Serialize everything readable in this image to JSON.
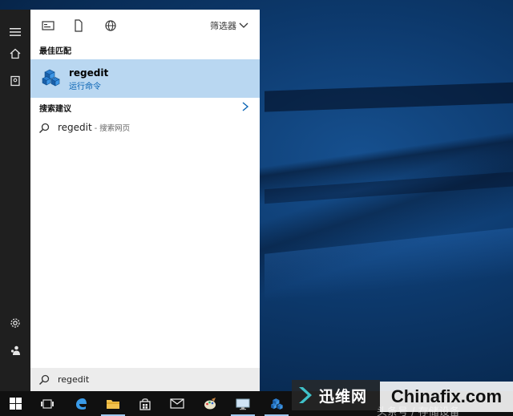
{
  "panel": {
    "filter_label": "筛选器",
    "best_match_label": "最佳匹配",
    "best_match": {
      "title": "regedit",
      "subtitle": "运行命令"
    },
    "suggestions_label": "搜索建议",
    "suggestions": [
      {
        "text": "regedit",
        "hint": " - 搜索网页"
      }
    ]
  },
  "search": {
    "value": "regedit"
  },
  "watermark": {
    "brand": "迅维网",
    "site": "Chinafix.com",
    "extra": "头条号 / 存储设备"
  },
  "colors": {
    "highlight": "#b9d7f1",
    "accent": "#0a64b4",
    "taskbar": "#101010",
    "rail": "#1f1f1f"
  }
}
